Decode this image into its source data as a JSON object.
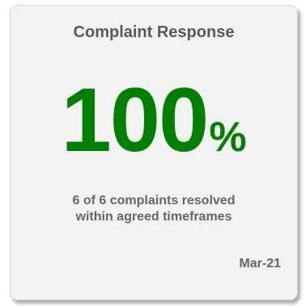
{
  "card": {
    "title": "Complaint Response",
    "metric": {
      "value": "100",
      "unit": "%"
    },
    "description": {
      "line1": "6 of 6 complaints resolved",
      "line2": "within agreed timeframes"
    },
    "date": "Mar-21"
  },
  "colors": {
    "metric": "#008000",
    "title_text": "#595959",
    "body_text": "#666666",
    "card_background": "#f2f2f2"
  }
}
